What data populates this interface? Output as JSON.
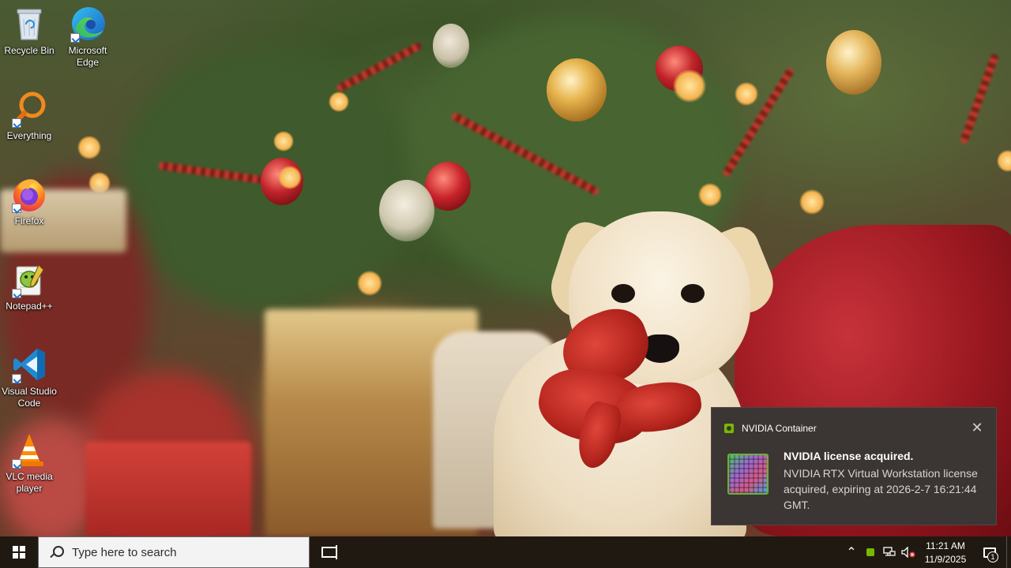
{
  "desktop": {
    "wallpaper": "Puppy with red bow in front of Christmas tree",
    "icons": [
      {
        "label": "Recycle Bin",
        "icon": "recycle-bin-icon"
      },
      {
        "label": "Microsoft Edge",
        "icon": "edge-icon"
      },
      {
        "label": "Everything",
        "icon": "everything-search-icon"
      },
      {
        "label": "Firefox",
        "icon": "firefox-icon"
      },
      {
        "label": "Notepad++",
        "icon": "notepad-plus-plus-icon"
      },
      {
        "label": "Visual Studio Code",
        "icon": "vscode-icon"
      },
      {
        "label": "VLC media player",
        "icon": "vlc-icon"
      }
    ]
  },
  "notification": {
    "app_name": "NVIDIA Container",
    "title": "NVIDIA license acquired.",
    "body": "NVIDIA RTX Virtual Workstation license acquired, expiring at 2026-2-7 16:21:44 GMT.",
    "close_glyph": "✕",
    "accent": "#76b900"
  },
  "taskbar": {
    "search_placeholder": "Type here to search",
    "tray": {
      "overflow_glyph": "⌃",
      "speaker_glyph": "🔈",
      "time": "11:21 AM",
      "date": "11/9/2025",
      "notification_count": "1"
    }
  }
}
